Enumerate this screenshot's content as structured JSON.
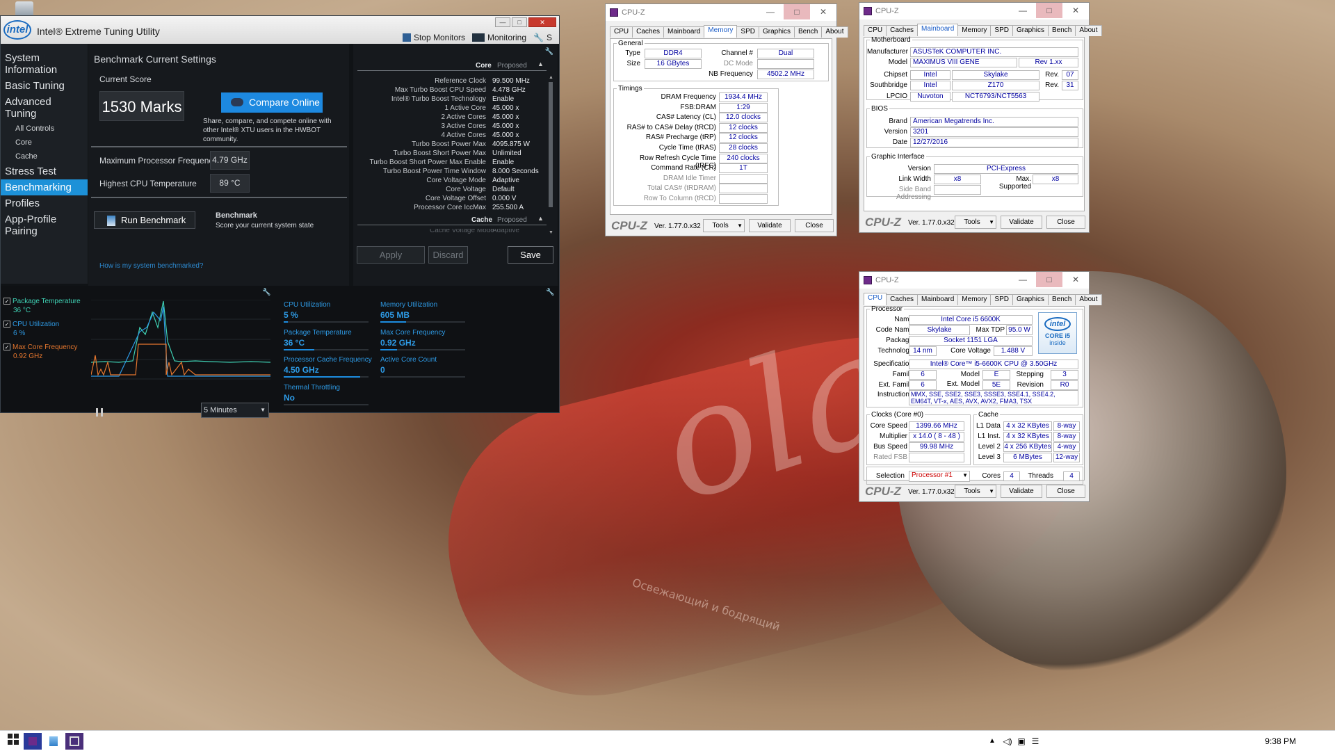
{
  "xtu": {
    "logo": "intel",
    "title": "Intel® Extreme Tuning Utility",
    "toolbar": {
      "stop_monitors": "Stop Monitors",
      "monitoring": "Monitoring",
      "s": "S"
    },
    "nav": [
      "System Information",
      "Basic Tuning",
      "Advanced Tuning",
      "All Controls",
      "Core",
      "Cache",
      "Stress Test",
      "Benchmarking",
      "Profiles",
      "App-Profile Pairing"
    ],
    "bench": {
      "heading": "Benchmark Current Settings",
      "current_score_label": "Current Score",
      "score": "1530 Marks",
      "compare_btn": "Compare Online",
      "share_text": "Share, compare, and compete online with other Intel® XTU users in the HWBOT community.",
      "max_freq_label": "Maximum Processor Frequency",
      "max_freq": "4.79 GHz",
      "highest_temp_label": "Highest CPU Temperature",
      "highest_temp": "89 °C",
      "run_btn": "Run Benchmark",
      "bench_title": "Benchmark",
      "bench_desc": "Score your current system state",
      "help_link": "How is my system benchmarked?"
    },
    "right": {
      "core_head": "Core",
      "proposed": "Proposed",
      "rows": [
        {
          "k": "Reference Clock",
          "v": "99.500 MHz"
        },
        {
          "k": "Max Turbo Boost CPU Speed",
          "v": "4.478 GHz"
        },
        {
          "k": "Intel® Turbo Boost Technology",
          "v": "Enable"
        },
        {
          "k": "1 Active Core",
          "v": "45.000 x"
        },
        {
          "k": "2 Active Cores",
          "v": "45.000 x"
        },
        {
          "k": "3 Active Cores",
          "v": "45.000 x"
        },
        {
          "k": "4 Active Cores",
          "v": "45.000 x"
        },
        {
          "k": "Turbo Boost Power Max",
          "v": "4095.875 W"
        },
        {
          "k": "Turbo Boost Short Power Max",
          "v": "Unlimited"
        },
        {
          "k": "Turbo Boost Short Power Max Enable",
          "v": "Enable"
        },
        {
          "k": "Turbo Boost Power Time Window",
          "v": "8.000 Seconds"
        },
        {
          "k": "Core Voltage Mode",
          "v": "Adaptive"
        },
        {
          "k": "Core Voltage",
          "v": "Default"
        },
        {
          "k": "Core Voltage Offset",
          "v": "0.000 V"
        },
        {
          "k": "Processor Core IccMax",
          "v": "255.500 A"
        }
      ],
      "cache_head": "Cache",
      "cache_proposed": "Proposed",
      "cache_cut_k": "Cache Voltage Mode",
      "cache_cut_v": "Adaptive",
      "apply": "Apply",
      "discard": "Discard",
      "save": "Save"
    },
    "monitors": {
      "legend": [
        {
          "name": "Package Temperature",
          "value": "36 °C",
          "color": "#3fd1b4"
        },
        {
          "name": "CPU Utilization",
          "value": "6 %",
          "color": "#2e9be6"
        },
        {
          "name": "Max Core Frequency",
          "value": "0.92 GHz",
          "color": "#e6772e"
        }
      ],
      "range": "5 Minutes",
      "tiles": [
        {
          "name": "CPU Utilization",
          "value": "5 %",
          "fill": 0.05
        },
        {
          "name": "Memory Utilization",
          "value": "605  MB",
          "fill": 0.3
        },
        {
          "name": "Package Temperature",
          "value": "36 °C",
          "fill": 0.36
        },
        {
          "name": "Max Core Frequency",
          "value": "0.92 GHz",
          "fill": 0.2
        },
        {
          "name": "Processor Cache Frequency",
          "value": "4.50 GHz",
          "fill": 0.9
        },
        {
          "name": "Active Core Count",
          "value": "0",
          "fill": 0
        },
        {
          "name": "Thermal Throttling",
          "value": "No",
          "fill": 0
        }
      ]
    }
  },
  "cpuz_common": {
    "title": "CPU-Z",
    "brand": "CPU-Z",
    "version": "Ver. 1.77.0.x32",
    "tools": "Tools",
    "validate": "Validate",
    "close": "Close",
    "tabs": [
      "CPU",
      "Caches",
      "Mainboard",
      "Memory",
      "SPD",
      "Graphics",
      "Bench",
      "About"
    ]
  },
  "memory": {
    "general": "General",
    "type_k": "Type",
    "type": "DDR4",
    "size_k": "Size",
    "size": "16 GBytes",
    "channel_k": "Channel #",
    "channel": "Dual",
    "dc_k": "DC Mode",
    "nb_k": "NB Frequency",
    "nb": "4502.2 MHz",
    "timings": "Timings",
    "rows": [
      {
        "k": "DRAM Frequency",
        "v": "1934.4 MHz"
      },
      {
        "k": "FSB:DRAM",
        "v": "1:29"
      },
      {
        "k": "CAS# Latency (CL)",
        "v": "12.0 clocks"
      },
      {
        "k": "RAS# to CAS# Delay (tRCD)",
        "v": "12 clocks"
      },
      {
        "k": "RAS# Precharge (tRP)",
        "v": "12 clocks"
      },
      {
        "k": "Cycle Time (tRAS)",
        "v": "28 clocks"
      },
      {
        "k": "Row Refresh Cycle Time (tRFC)",
        "v": "240 clocks"
      },
      {
        "k": "Command Rate (CR)",
        "v": "1T"
      },
      {
        "k": "DRAM Idle Timer",
        "v": ""
      },
      {
        "k": "Total CAS# (tRDRAM)",
        "v": ""
      },
      {
        "k": "Row To Column (tRCD)",
        "v": ""
      }
    ]
  },
  "mainboard": {
    "mb": "Motherboard",
    "manu_k": "Manufacturer",
    "manu": "ASUSTeK COMPUTER INC.",
    "model_k": "Model",
    "model": "MAXIMUS VIII GENE",
    "model_rev": "Rev 1.xx",
    "chipset_k": "Chipset",
    "chipset": "Intel",
    "chipset2": "Skylake",
    "rev_k": "Rev.",
    "chipset_rev": "07",
    "south_k": "Southbridge",
    "south": "Intel",
    "south2": "Z170",
    "south_rev": "31",
    "lpcio_k": "LPCIO",
    "lpcio": "Nuvoton",
    "lpcio2": "NCT6793/NCT5563",
    "bios": "BIOS",
    "brand_k": "Brand",
    "brand": "American Megatrends Inc.",
    "ver_k": "Version",
    "ver": "3201",
    "date_k": "Date",
    "date": "12/27/2016",
    "gi": "Graphic Interface",
    "gver_k": "Version",
    "gver": "PCI-Express",
    "lw_k": "Link Width",
    "lw": "x8",
    "ms_k": "Max. Supported",
    "ms": "x8",
    "sba_k": "Side Band Addressing"
  },
  "cpu": {
    "proc": "Processor",
    "name_k": "Name",
    "name": "Intel Core i5 6600K",
    "code_k": "Code Name",
    "code": "Skylake",
    "tdp_k": "Max TDP",
    "tdp": "95.0 W",
    "pkg_k": "Package",
    "pkg": "Socket 1151 LGA",
    "tech_k": "Technology",
    "tech": "14 nm",
    "cv_k": "Core Voltage",
    "cv": "1.488 V",
    "spec_k": "Specification",
    "spec": "Intel® Core™ i5-6600K CPU @ 3.50GHz",
    "fam_k": "Family",
    "fam": "6",
    "model_k": "Model",
    "model": "E",
    "step_k": "Stepping",
    "step": "3",
    "efam_k": "Ext. Family",
    "efam": "6",
    "emod_k": "Ext. Model",
    "emod": "5E",
    "rev_k": "Revision",
    "rev": "R0",
    "inst_k": "Instructions",
    "inst": "MMX, SSE, SSE2, SSE3, SSSE3, SSE4.1, SSE4.2, EM64T, VT-x, AES, AVX, AVX2, FMA3, TSX",
    "badge_logo": "intel",
    "badge_line": "CORE i5",
    "badge_sub": "inside",
    "clocks": "Clocks (Core #0)",
    "cs_k": "Core Speed",
    "cs": "1399.66 MHz",
    "mul_k": "Multiplier",
    "mul": "x 14.0 ( 8 - 48 )",
    "bus_k": "Bus Speed",
    "bus": "99.98 MHz",
    "fsb_k": "Rated FSB",
    "cache": "Cache",
    "l1d_k": "L1 Data",
    "l1d": "4 x 32 KBytes",
    "l1d_w": "8-way",
    "l1i_k": "L1 Inst.",
    "l1i": "4 x 32 KBytes",
    "l1i_w": "8-way",
    "l2_k": "Level 2",
    "l2": "4 x 256 KBytes",
    "l2_w": "4-way",
    "l3_k": "Level 3",
    "l3": "6 MBytes",
    "l3_w": "12-way",
    "sel_k": "Selection",
    "sel": "Processor #1",
    "cores_k": "Cores",
    "cores": "4",
    "threads_k": "Threads",
    "threads": "4"
  },
  "taskbar": {
    "time": "9:38 PM"
  }
}
